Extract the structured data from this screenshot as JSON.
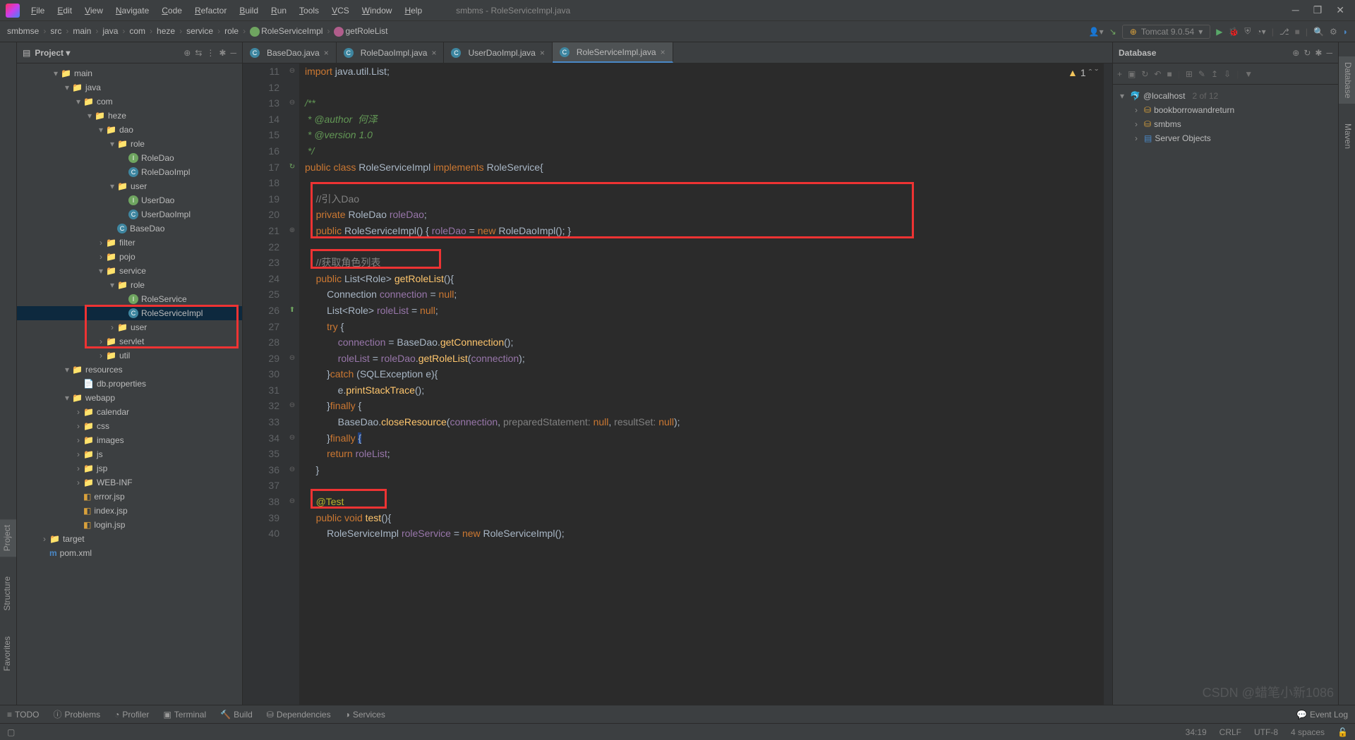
{
  "window": {
    "title": "smbms - RoleServiceImpl.java"
  },
  "menu": [
    "File",
    "Edit",
    "View",
    "Navigate",
    "Code",
    "Refactor",
    "Build",
    "Run",
    "Tools",
    "VCS",
    "Window",
    "Help"
  ],
  "breadcrumbs": [
    "smbmse",
    "src",
    "main",
    "java",
    "com",
    "heze",
    "service",
    "role",
    "RoleServiceImpl",
    "getRoleList"
  ],
  "runConfig": "Tomcat 9.0.54",
  "projectPanel": {
    "title": "Project"
  },
  "tree": {
    "nodes": [
      {
        "d": 3,
        "t": "main",
        "ico": "folder",
        "tw": "v"
      },
      {
        "d": 4,
        "t": "java",
        "ico": "folder",
        "tw": "v"
      },
      {
        "d": 5,
        "t": "com",
        "ico": "folder",
        "tw": "v"
      },
      {
        "d": 6,
        "t": "heze",
        "ico": "folder",
        "tw": "v"
      },
      {
        "d": 7,
        "t": "dao",
        "ico": "folder",
        "tw": "v"
      },
      {
        "d": 8,
        "t": "role",
        "ico": "folder",
        "tw": "v"
      },
      {
        "d": 9,
        "t": "RoleDao",
        "ico": "cls-i"
      },
      {
        "d": 9,
        "t": "RoleDaoImpl",
        "ico": "cls-c"
      },
      {
        "d": 8,
        "t": "user",
        "ico": "folder",
        "tw": "v"
      },
      {
        "d": 9,
        "t": "UserDao",
        "ico": "cls-i"
      },
      {
        "d": 9,
        "t": "UserDaoImpl",
        "ico": "cls-c"
      },
      {
        "d": 8,
        "t": "BaseDao",
        "ico": "cls-c"
      },
      {
        "d": 7,
        "t": "filter",
        "ico": "folder",
        "tw": ">"
      },
      {
        "d": 7,
        "t": "pojo",
        "ico": "folder",
        "tw": ">"
      },
      {
        "d": 7,
        "t": "service",
        "ico": "folder",
        "tw": "v"
      },
      {
        "d": 8,
        "t": "role",
        "ico": "folder",
        "tw": "v"
      },
      {
        "d": 9,
        "t": "RoleService",
        "ico": "cls-i"
      },
      {
        "d": 9,
        "t": "RoleServiceImpl",
        "ico": "cls-c",
        "sel": true
      },
      {
        "d": 8,
        "t": "user",
        "ico": "folder",
        "tw": ">"
      },
      {
        "d": 7,
        "t": "servlet",
        "ico": "folder",
        "tw": ">"
      },
      {
        "d": 7,
        "t": "util",
        "ico": "folder",
        "tw": ">"
      },
      {
        "d": 4,
        "t": "resources",
        "ico": "folder-res",
        "tw": "v"
      },
      {
        "d": 5,
        "t": "db.properties",
        "ico": "file"
      },
      {
        "d": 4,
        "t": "webapp",
        "ico": "folder-web",
        "tw": "v"
      },
      {
        "d": 5,
        "t": "calendar",
        "ico": "folder",
        "tw": ">"
      },
      {
        "d": 5,
        "t": "css",
        "ico": "folder",
        "tw": ">"
      },
      {
        "d": 5,
        "t": "images",
        "ico": "folder",
        "tw": ">"
      },
      {
        "d": 5,
        "t": "js",
        "ico": "folder",
        "tw": ">"
      },
      {
        "d": 5,
        "t": "jsp",
        "ico": "folder",
        "tw": ">"
      },
      {
        "d": 5,
        "t": "WEB-INF",
        "ico": "folder",
        "tw": ">"
      },
      {
        "d": 5,
        "t": "error.jsp",
        "ico": "jsp"
      },
      {
        "d": 5,
        "t": "index.jsp",
        "ico": "jsp"
      },
      {
        "d": 5,
        "t": "login.jsp",
        "ico": "jsp"
      },
      {
        "d": 2,
        "t": "target",
        "ico": "folder-t",
        "tw": ">"
      },
      {
        "d": 2,
        "t": "pom.xml",
        "ico": "xml"
      }
    ]
  },
  "tabs": [
    {
      "label": "BaseDao.java",
      "ico": "cls-c"
    },
    {
      "label": "RoleDaoImpl.java",
      "ico": "cls-c"
    },
    {
      "label": "UserDaoImpl.java",
      "ico": "cls-c"
    },
    {
      "label": "RoleServiceImpl.java",
      "ico": "cls-c",
      "active": true
    }
  ],
  "warnings": {
    "count": "1"
  },
  "code": {
    "startLine": 11,
    "lines": [
      "import java.util.List;",
      "",
      "/**",
      " * @author  何泽",
      " * @version 1.0",
      " */",
      "public class RoleServiceImpl implements RoleService{",
      "",
      "    //引入Dao",
      "    private RoleDao roleDao;",
      "    public RoleServiceImpl() { roleDao = new RoleDaoImpl(); }",
      "",
      "    //获取角色列表",
      "    public List<Role> getRoleList(){",
      "        Connection connection = null;",
      "        List<Role> roleList = null;",
      "        try {",
      "            connection = BaseDao.getConnection();",
      "            roleList = roleDao.getRoleList(connection);",
      "        }catch (SQLException e){",
      "            e.printStackTrace();",
      "        }finally {",
      "            BaseDao.closeResource(connection, preparedStatement: null, resultSet: null);",
      "        }",
      "        return roleList;",
      "    }",
      "",
      "    @Test",
      "    public void test(){",
      "        RoleServiceImpl roleService = new RoleServiceImpl();"
    ]
  },
  "dbPanel": {
    "title": "Database",
    "conn": "@localhost",
    "connCount": "2 of 12",
    "items": [
      "bookborrowandreturn",
      "smbms",
      "Server Objects"
    ]
  },
  "bottomTools": [
    "TODO",
    "Problems",
    "Profiler",
    "Terminal",
    "Build",
    "Dependencies",
    "Services"
  ],
  "eventLog": "Event Log",
  "status": {
    "pos": "34:19",
    "enc": "CRLF",
    "encoding": "UTF-8",
    "spaces": "4 spaces"
  },
  "watermark": "CSDN @蜡笔小新1086",
  "leftGutter": [
    "Structure",
    "Favorites"
  ],
  "rightGutter": [
    "Database",
    "Maven"
  ],
  "leftGutterTop": "Project"
}
